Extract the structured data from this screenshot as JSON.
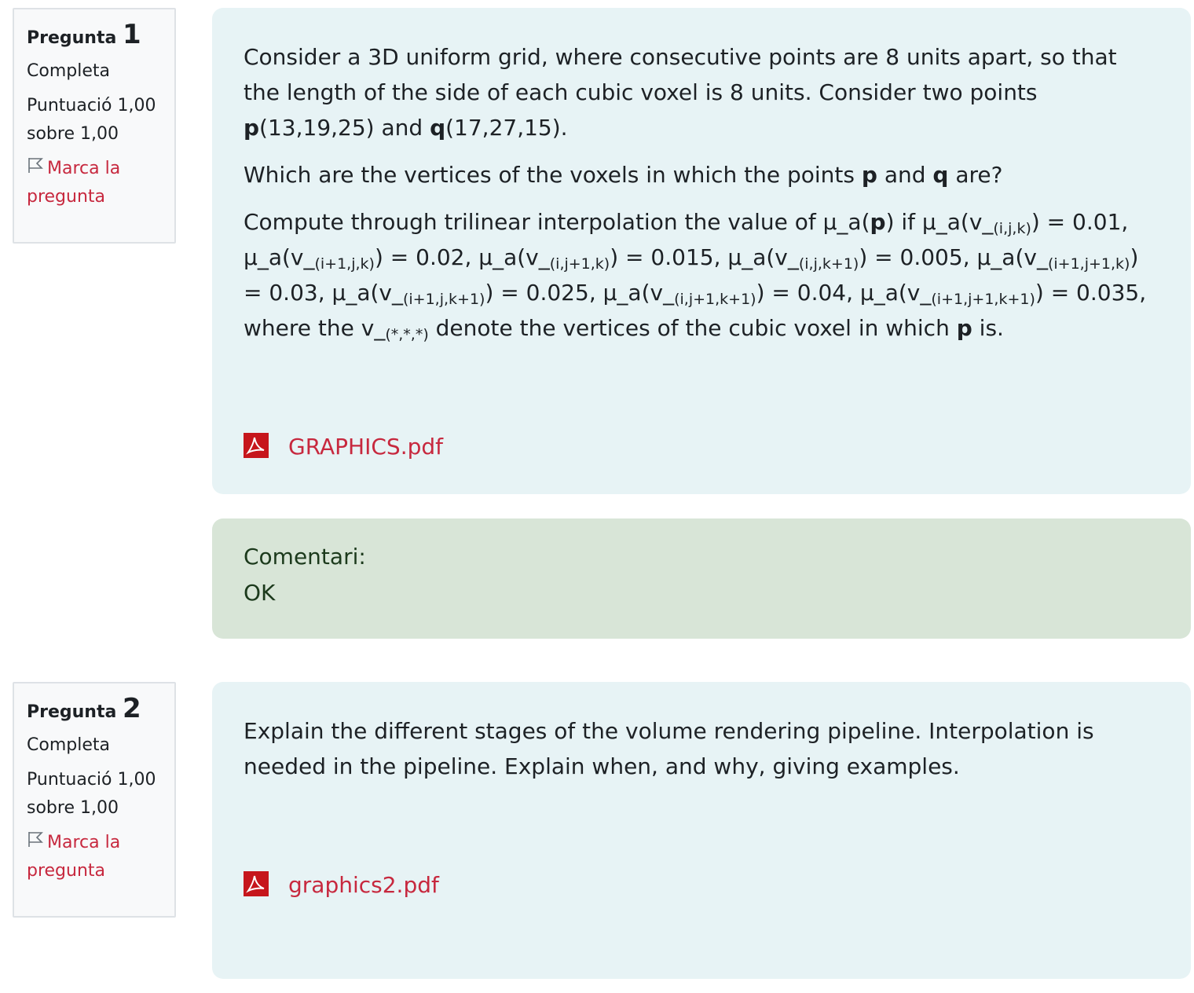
{
  "q1": {
    "label": "Pregunta",
    "number": "1",
    "state": "Completa",
    "grade_line1": "Puntuació 1,00",
    "grade_line2": "sobre 1,00",
    "flag_line1": "Marca la",
    "flag_line2": "pregunta",
    "para1": {
      "t1": "Consider a 3D uniform grid, where consecutive points are 8 units apart, so that the length of the side of each cubic voxel is 8 units. Consider two points ",
      "p": "p",
      "t2": "(13,19,25) and ",
      "q": "q",
      "t3": "(17,27,15)."
    },
    "para2": {
      "t1": "Which are the vertices of the voxels in which the points ",
      "p": "p",
      "t2": " and ",
      "q": "q",
      "t3": " are?"
    },
    "para3": {
      "t1": "Compute through trilinear interpolation the value of μ_a(",
      "p": "p",
      "t2": ") if μ_a(v_",
      "s1": "(i,j,k)",
      "t3": ") = 0.01, μ_a(v_",
      "s2": "(i+1,j,k)",
      "t4": ") = 0.02, μ_a(v_",
      "s3": "(i,j+1,k)",
      "t5": ") = 0.015, μ_a(v_",
      "s4": "(i,j,k+1)",
      "t6": ") =  0.005, μ_a(v_",
      "s5": "(i+1,j+1,k)",
      "t7": ") = 0.03, μ_a(v_",
      "s6": "(i+1,j,k+1)",
      "t8": ") = 0.025, μ_a(v_",
      "s7": "(i,j+1,k+1)",
      "t9": ") = 0.04, μ_a(v_",
      "s8": "(i+1,j+1,k+1)",
      "t10": ") = 0.035, where the v_",
      "s9": "(*,*,*)",
      "t11": " denote the vertices of the cubic voxel in which ",
      "p2": "p",
      "t12": " is."
    },
    "attachment": "GRAPHICS.pdf",
    "feedback_label": "Comentari:",
    "feedback_text": "OK"
  },
  "q2": {
    "label": "Pregunta",
    "number": "2",
    "state": "Completa",
    "grade_line1": "Puntuació 1,00",
    "grade_line2": "sobre 1,00",
    "flag_line1": "Marca la",
    "flag_line2": "pregunta",
    "text": "Explain the different stages of the volume rendering pipeline. Interpolation is needed in the pipeline. Explain when, and why, giving examples.",
    "attachment": "graphics2.pdf"
  },
  "colors": {
    "link": "#c7283e",
    "question_bg": "#e7f3f5",
    "feedback_bg": "#d8e5d7",
    "info_bg": "#f8f9fa"
  },
  "icons": [
    "flag-icon",
    "pdf-icon"
  ]
}
